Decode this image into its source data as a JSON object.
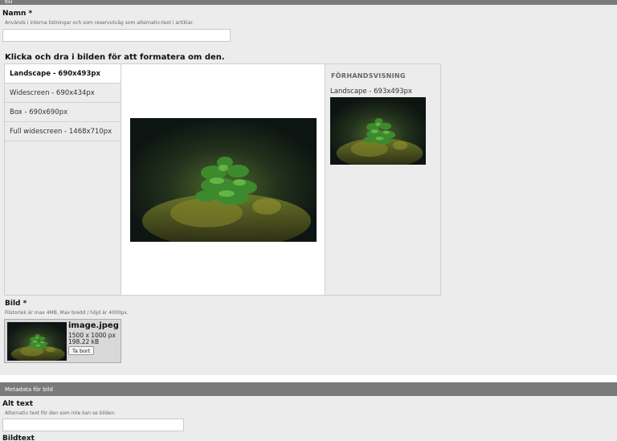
{
  "image_section": {
    "header": "Bild",
    "name_label": "Namn *",
    "name_help": "Används i interna listningar och som reservutväg som alternativ-text i artiklar.",
    "name_value": "",
    "crop_instructions": "Klicka och dra i bilden för att formatera om den.",
    "ratios": [
      {
        "label": "Landscape - 690x493px",
        "active": true
      },
      {
        "label": "Widescreen - 690x434px",
        "active": false
      },
      {
        "label": "Box - 690x690px",
        "active": false
      },
      {
        "label": "Full widescreen - 1468x710px",
        "active": false
      }
    ],
    "preview_heading": "FÖRHANDSVISNING",
    "preview_label": "Landscape - 693x493px",
    "file_label": "Bild *",
    "file_help": "Filstorlek är max 4MB. Max bredd / höjd är 4000px.",
    "file": {
      "name": "image.jpeg",
      "dimensions": "1500 x 1000 px",
      "size": "198.22 kB",
      "remove_label": "Ta bort"
    }
  },
  "metadata_section": {
    "header": "Metadata för bild",
    "alt_label": "Alt text",
    "alt_help": "Alternativ text för den som inte kan se bilden.",
    "alt_value": "",
    "caption_label": "Bildtext"
  },
  "colors": {
    "section_bar": "#7a7a7a",
    "panel_bg": "#ececec"
  }
}
